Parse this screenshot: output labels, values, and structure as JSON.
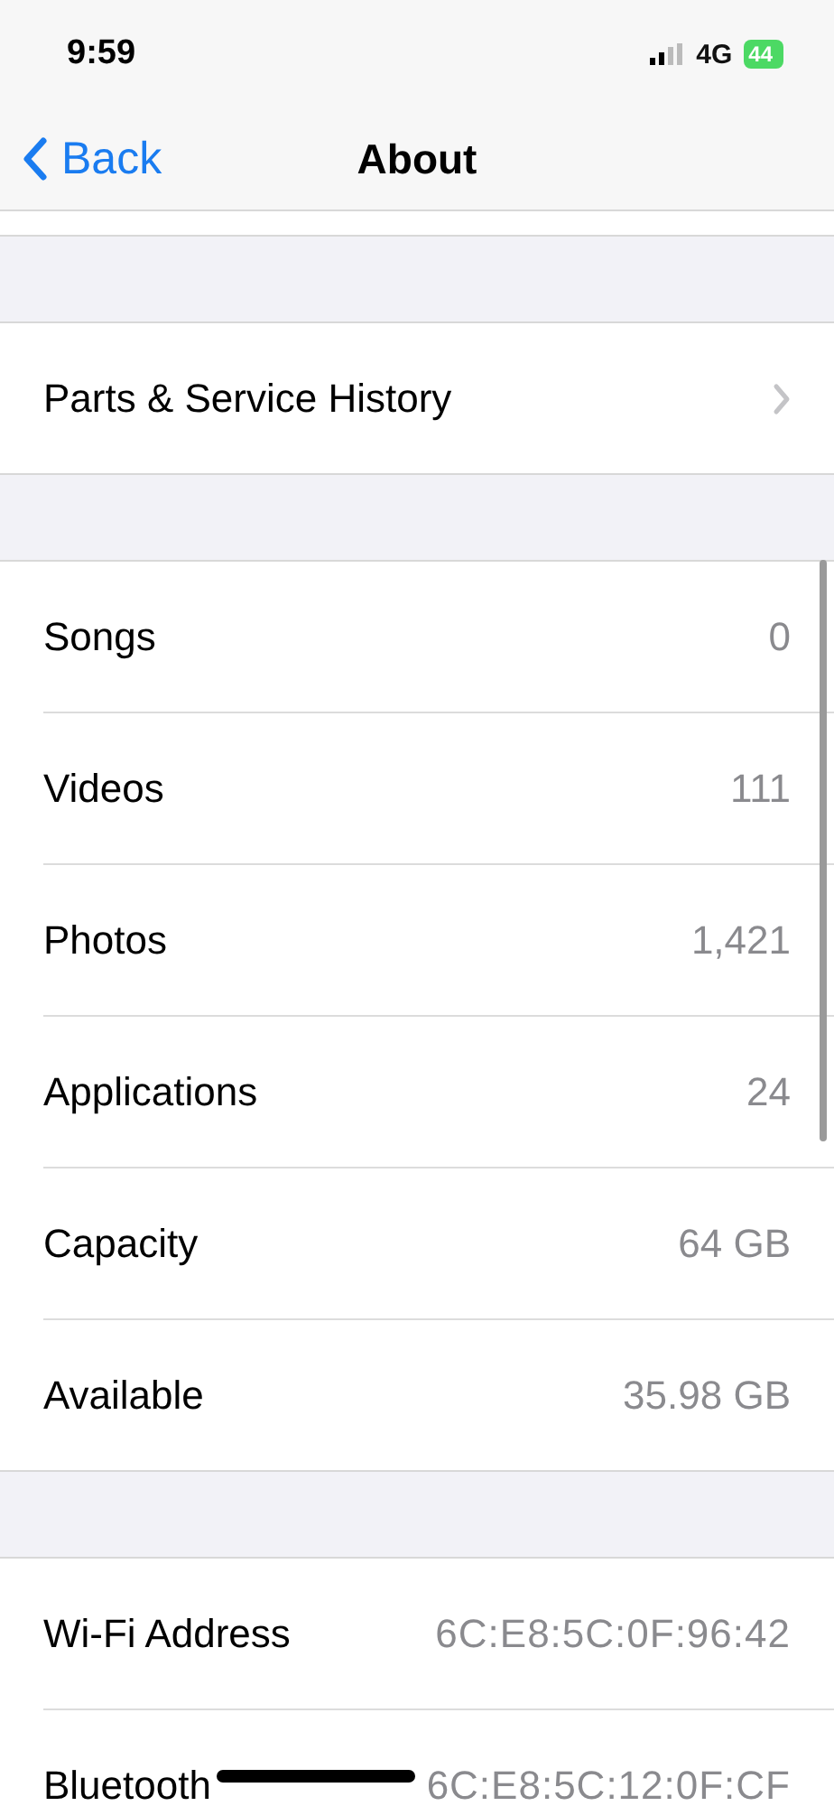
{
  "status_bar": {
    "time": "9:59",
    "network": "4G",
    "battery": "44"
  },
  "nav": {
    "back": "Back",
    "title": "About"
  },
  "sections": [
    {
      "rows": [
        {
          "kind": "chevron",
          "label": "Parts & Service History"
        }
      ]
    },
    {
      "rows": [
        {
          "kind": "value",
          "label": "Songs",
          "value": "0"
        },
        {
          "kind": "value",
          "label": "Videos",
          "value": "111"
        },
        {
          "kind": "value",
          "label": "Photos",
          "value": "1,421"
        },
        {
          "kind": "value",
          "label": "Applications",
          "value": "24"
        },
        {
          "kind": "value",
          "label": "Capacity",
          "value": "64 GB"
        },
        {
          "kind": "value",
          "label": "Available",
          "value": "35.98 GB"
        }
      ]
    },
    {
      "rows": [
        {
          "kind": "mono",
          "label": "Wi-Fi Address",
          "value": "6C:E8:5C:0F:96:42"
        },
        {
          "kind": "mono",
          "label": "Bluetooth",
          "value": "6C:E8:5C:12:0F:CF"
        }
      ]
    }
  ]
}
